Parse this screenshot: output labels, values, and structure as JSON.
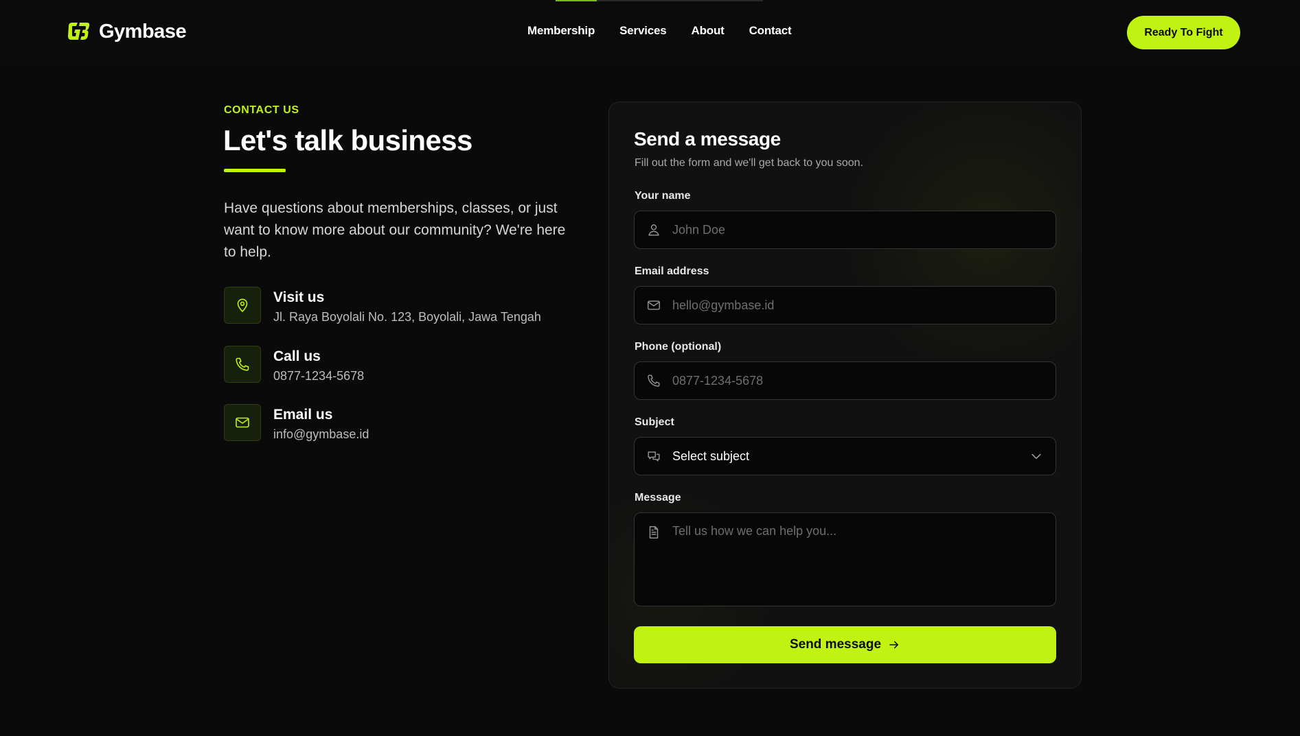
{
  "header": {
    "brand": {
      "name": "Gymbase",
      "logo_icon": "gb-logo-icon"
    },
    "nav": [
      {
        "label": "Membership"
      },
      {
        "label": "Services"
      },
      {
        "label": "About"
      },
      {
        "label": "Contact"
      }
    ],
    "cta_label": "Ready To Fight"
  },
  "contact": {
    "eyebrow": "CONTACT US",
    "title": "Let's talk business",
    "intro": "Have questions about memberships, classes, or just want to know more about our community? We're here to help.",
    "items": [
      {
        "icon": "map-pin-icon",
        "title": "Visit us",
        "detail": "Jl. Raya Boyolali No. 123, Boyolali, Jawa Tengah"
      },
      {
        "icon": "phone-icon",
        "title": "Call us",
        "detail": "0877-1234-5678"
      },
      {
        "icon": "mail-icon",
        "title": "Email us",
        "detail": "info@gymbase.id"
      }
    ]
  },
  "form": {
    "title": "Send a message",
    "subtitle": "Fill out the form and we'll get back to you soon.",
    "fields": {
      "name": {
        "label": "Your name",
        "placeholder": "John Doe",
        "value": "",
        "icon": "user-icon"
      },
      "email": {
        "label": "Email address",
        "placeholder": "hello@gymbase.id",
        "value": "",
        "icon": "mail-icon"
      },
      "phone": {
        "label": "Phone (optional)",
        "placeholder": "0877-1234-5678",
        "value": "",
        "icon": "phone-icon"
      },
      "subject": {
        "label": "Subject",
        "selected": "Select subject",
        "icon": "chat-icon"
      },
      "message": {
        "label": "Message",
        "placeholder": "Tell us how we can help you...",
        "value": "",
        "icon": "file-text-icon"
      }
    },
    "submit_label": "Send message"
  },
  "colors": {
    "accent": "#c1f312",
    "background": "#0a0a0a",
    "card": "#111111",
    "input": "#070707"
  }
}
